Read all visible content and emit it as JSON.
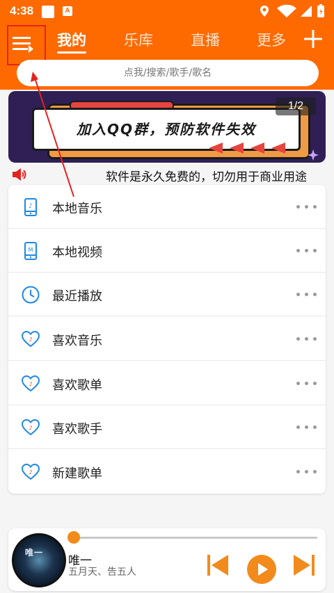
{
  "status_bar": {
    "time": "4:38",
    "notification_letter": "A"
  },
  "nav": {
    "tabs": [
      {
        "label": "我的",
        "active": true
      },
      {
        "label": "乐库",
        "active": false
      },
      {
        "label": "直播",
        "active": false
      },
      {
        "label": "更多",
        "active": false
      }
    ]
  },
  "search": {
    "placeholder": "点我/搜索/歌手/歌名"
  },
  "banner": {
    "text": "加入QQ群，预防软件失效",
    "counter": "1/2"
  },
  "notice": {
    "text": "软件是永久免费的，切勿用于商业用途"
  },
  "list": {
    "items": [
      {
        "label": "本地音乐",
        "icon": "local-music-icon"
      },
      {
        "label": "本地视频",
        "icon": "local-video-icon"
      },
      {
        "label": "最近播放",
        "icon": "clock-icon"
      },
      {
        "label": "喜欢音乐",
        "icon": "heart-music-icon"
      },
      {
        "label": "喜欢歌单",
        "icon": "heart-music-icon"
      },
      {
        "label": "喜欢歌手",
        "icon": "heart-music-icon"
      },
      {
        "label": "新建歌单",
        "icon": "heart-music-icon"
      }
    ]
  },
  "player": {
    "title": "唯一",
    "artist": "五月天、告五人",
    "cover_text": "唯一",
    "progress": 0.0
  },
  "colors": {
    "accent": "#ff6a00",
    "icon_blue": "#1e88e5",
    "player_orange": "#f28b1c",
    "annotation_red": "#e3231e"
  }
}
